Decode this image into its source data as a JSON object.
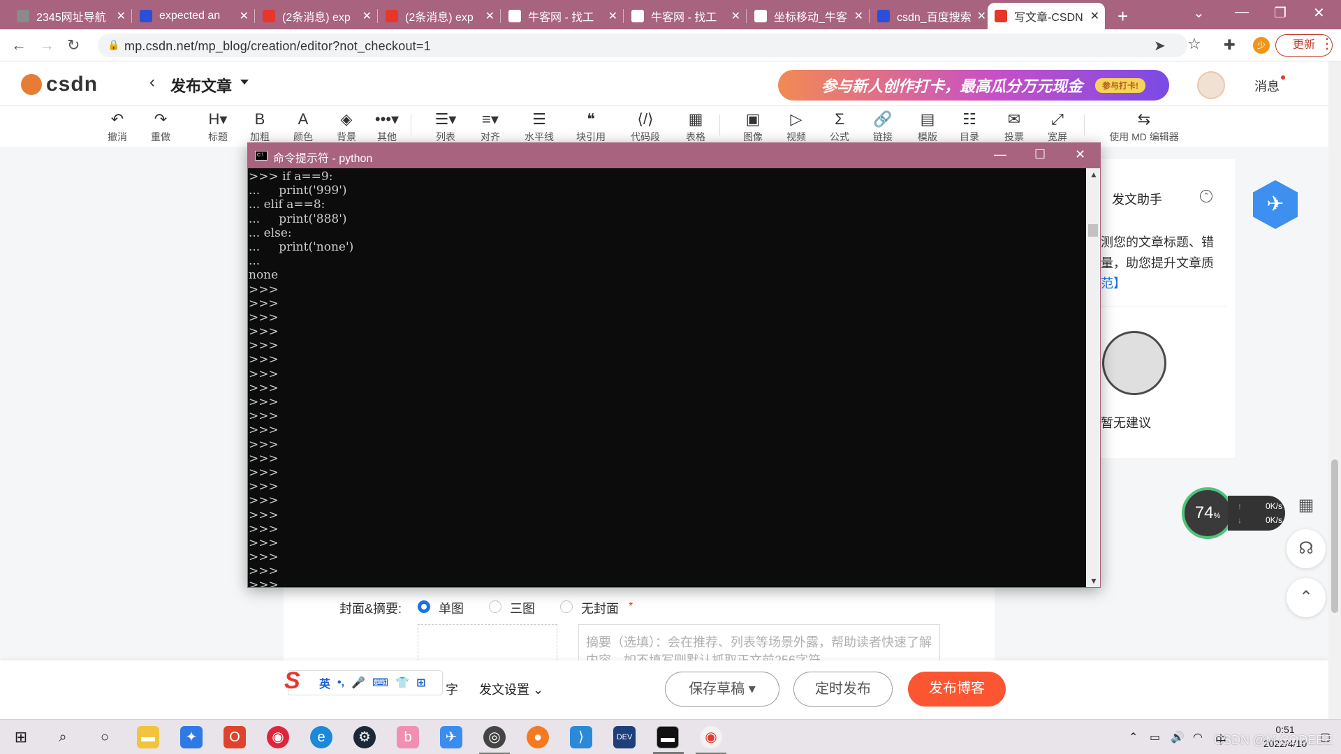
{
  "browser": {
    "tabs": [
      {
        "title": "2345网址导航",
        "icon": "globe-icon",
        "color": "#8a8a8a"
      },
      {
        "title": "expected an",
        "icon": "baidu-paw-icon",
        "color": "#2b4fd8"
      },
      {
        "title": "(2条消息) exp",
        "icon": "csdn-c-icon",
        "color": "#e6372a"
      },
      {
        "title": "(2条消息) exp",
        "icon": "csdn-c-icon",
        "color": "#e6372a"
      },
      {
        "title": "牛客网 - 找工",
        "icon": "nowcoder-icon",
        "color": "#ffffff"
      },
      {
        "title": "牛客网 - 找工",
        "icon": "nowcoder-icon",
        "color": "#ffffff"
      },
      {
        "title": "坐标移动_牛客",
        "icon": "nowcoder-icon",
        "color": "#ffffff"
      },
      {
        "title": "csdn_百度搜索",
        "icon": "baidu-paw-icon",
        "color": "#2b4fd8"
      },
      {
        "title": "写文章-CSDN",
        "icon": "csdn-c-icon",
        "color": "#e6372a",
        "active": true
      }
    ],
    "url": "mp.csdn.net/mp_blog/creation/editor?not_checkout=1",
    "update_label": "更新",
    "profile_initial": "少"
  },
  "header": {
    "logo_text": "csdn",
    "page_title": "发布文章",
    "banner_text": "参与新人创作打卡，最高瓜分万元现金",
    "banner_pill": "参与打卡!",
    "messages_label": "消息"
  },
  "toolbar": {
    "items": [
      {
        "label": "撤消",
        "icon": "↶"
      },
      {
        "label": "重做",
        "icon": "↷"
      },
      {
        "label": "标题",
        "icon": "H▾"
      },
      {
        "label": "加粗",
        "icon": "B"
      },
      {
        "label": "颜色",
        "icon": "A"
      },
      {
        "label": "背景",
        "icon": "◈"
      },
      {
        "label": "其他",
        "icon": "•••▾"
      },
      {
        "label": "列表",
        "icon": "☰▾"
      },
      {
        "label": "对齐",
        "icon": "≡▾"
      },
      {
        "label": "水平线",
        "icon": "☰"
      },
      {
        "label": "块引用",
        "icon": "❝"
      },
      {
        "label": "代码段",
        "icon": "⟨/⟩"
      },
      {
        "label": "表格",
        "icon": "▦"
      },
      {
        "label": "图像",
        "icon": "▣"
      },
      {
        "label": "视频",
        "icon": "▷"
      },
      {
        "label": "公式",
        "icon": "Σ"
      },
      {
        "label": "链接",
        "icon": "🔗"
      },
      {
        "label": "模版",
        "icon": "▤"
      },
      {
        "label": "目录",
        "icon": "☷"
      },
      {
        "label": "投票",
        "icon": "✉"
      },
      {
        "label": "宽屏",
        "icon": "⤢"
      }
    ],
    "md_editor_label": "使用 MD 编辑器"
  },
  "cmd": {
    "title": "命令提示符 - python",
    "lines": [
      ">>> if a==9:",
      "...     print('999')",
      "... elif a==8:",
      "...     print('888')",
      "... else:",
      "...     print('none')",
      "...",
      "none",
      ">>>",
      ">>>",
      ">>>",
      ">>>",
      ">>>",
      ">>>",
      ">>>",
      ">>>",
      ">>>",
      ">>>",
      ">>>",
      ">>>",
      ">>>",
      ">>>",
      ">>>",
      ">>>",
      ">>>",
      ">>>",
      ">>>",
      ">>>",
      ">>>",
      ">>>",
      ">>>"
    ]
  },
  "assistant": {
    "title": "发文助手",
    "text": "测您的文章标题、错量，助您提升文章质",
    "link": "范】",
    "empty": "暂无建议"
  },
  "speed": {
    "percent": "74",
    "percent_unit": "%",
    "up": "0K/s",
    "down": "0K/s"
  },
  "cover": {
    "label": "封面&摘要:",
    "options": [
      "单图",
      "三图",
      "无封面"
    ],
    "selected": "单图",
    "required_mark": "*",
    "abstract_placeholder": "摘要（选填）：会在推荐、列表等场景外露，帮助读者快速了解内容，如不填写则默认抓取正文前256字符"
  },
  "actions": {
    "ime_lang": "英",
    "word_suffix": "字",
    "publish_settings": "发文设置",
    "save_draft": "保存草稿",
    "schedule": "定时发布",
    "publish": "发布博客"
  },
  "taskbar": {
    "time": "0:51",
    "date": "2022/4/10",
    "ime": "中",
    "watermark": "CSDN @M.CODEEE"
  }
}
